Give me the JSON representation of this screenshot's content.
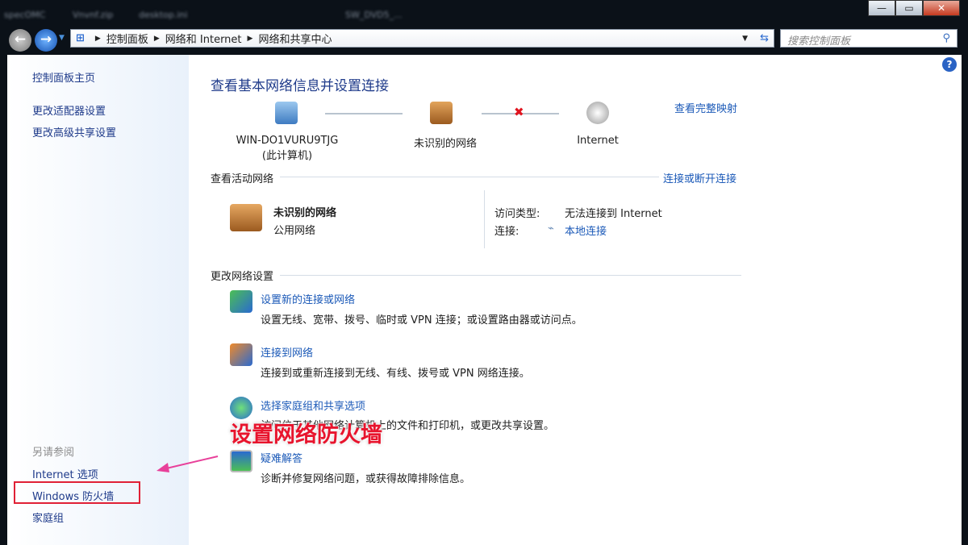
{
  "desktop_items": [
    "specOMC",
    "Vnvnf.zip",
    "desktop.ini",
    "SW_DVD5_..."
  ],
  "window_buttons": {
    "minimize": "—",
    "maximize": "▭",
    "close": "✕"
  },
  "address": {
    "crumbs": [
      "控制面板",
      "网络和 Internet",
      "网络和共享中心"
    ],
    "search_placeholder": "搜索控制面板"
  },
  "sidebar": {
    "items": [
      "控制面板主页",
      "更改适配器设置",
      "更改高级共享设置"
    ],
    "see_also_title": "另请参阅",
    "see_also": [
      "Internet 选项",
      "Windows 防火墙",
      "家庭组"
    ]
  },
  "main": {
    "title": "查看基本网络信息并设置连接",
    "full_map": "查看完整映射",
    "map": {
      "computer": "WIN-DO1VURU9TJG",
      "computer_sub": "(此计算机)",
      "network": "未识别的网络",
      "internet": "Internet"
    },
    "active_title": "查看活动网络",
    "connect_link": "连接或断开连接",
    "active": {
      "name": "未识别的网络",
      "type": "公用网络",
      "access_label": "访问类型:",
      "access_value": "无法连接到 Internet",
      "conn_label": "连接:",
      "conn_value": "本地连接"
    },
    "change_title": "更改网络设置",
    "tasks": [
      {
        "title": "设置新的连接或网络",
        "desc": "设置无线、宽带、拨号、临时或 VPN 连接；或设置路由器或访问点。"
      },
      {
        "title": "连接到网络",
        "desc": "连接到或重新连接到无线、有线、拨号或 VPN 网络连接。"
      },
      {
        "title": "选择家庭组和共享选项",
        "desc": "访问位于其他网络计算机上的文件和打印机，或更改共享设置。"
      },
      {
        "title": "疑难解答",
        "desc": "诊断并修复网络问题，或获得故障排除信息。"
      }
    ]
  },
  "annotation": "设置网络防火墙",
  "colors": {
    "link": "#1c5ab8",
    "annotation": "#e8142d"
  }
}
